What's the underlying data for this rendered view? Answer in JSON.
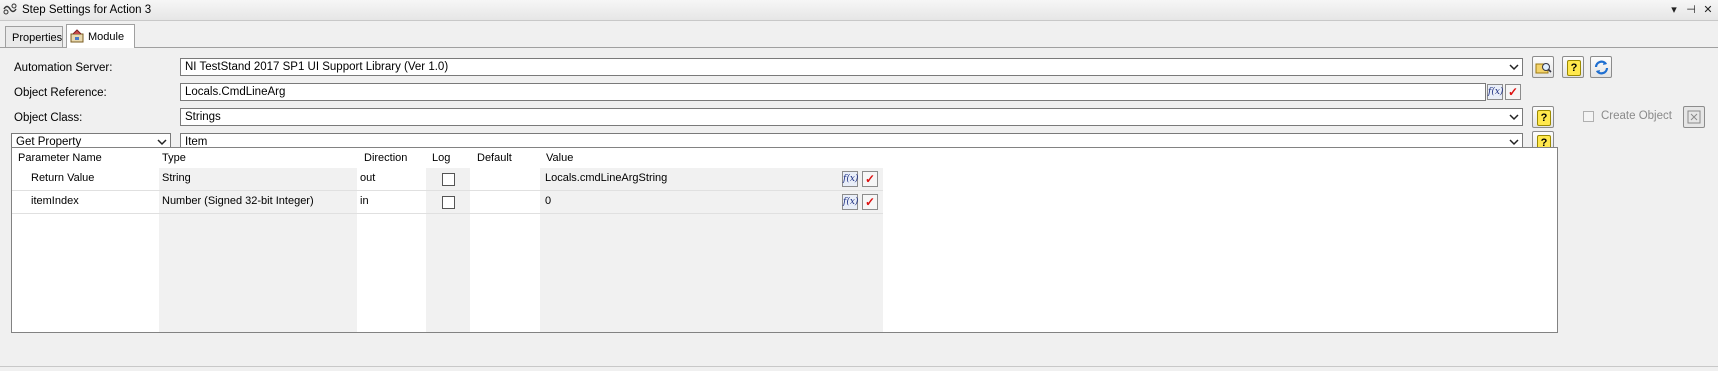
{
  "window": {
    "title": "Step Settings for Action 3",
    "controls": [
      "▾",
      "⊣",
      "✕"
    ]
  },
  "tabs": [
    {
      "label": "Properties"
    },
    {
      "label": "Module"
    }
  ],
  "form": {
    "automation_server_label": "Automation Server:",
    "automation_server_value": "NI TestStand 2017 SP1 UI Support Library (Ver 1.0)",
    "object_reference_label": "Object Reference:",
    "object_reference_value": "Locals.CmdLineArg",
    "object_class_label": "Object Class:",
    "object_class_value": "Strings",
    "action_value": "Get Property",
    "member_value": "Item",
    "create_object_label": "Create Object",
    "help_glyph": "?",
    "fx_glyph": "f(x)",
    "check_glyph": "✓"
  },
  "grid": {
    "columns": [
      "Parameter Name",
      "Type",
      "Direction",
      "Log",
      "Default",
      "Value"
    ],
    "rows": [
      {
        "name": "Return Value",
        "type": "String",
        "direction": "out",
        "log": false,
        "default": "",
        "value": "Locals.cmdLineArgString"
      },
      {
        "name": "itemIndex",
        "type": "Number (Signed 32-bit Integer)",
        "direction": "in",
        "log": false,
        "default": "",
        "value": "0"
      }
    ]
  },
  "colors": {
    "accent_red": "#d11111",
    "help_yellow": "#ffe84d",
    "refresh_blue": "#1f6fd0"
  }
}
